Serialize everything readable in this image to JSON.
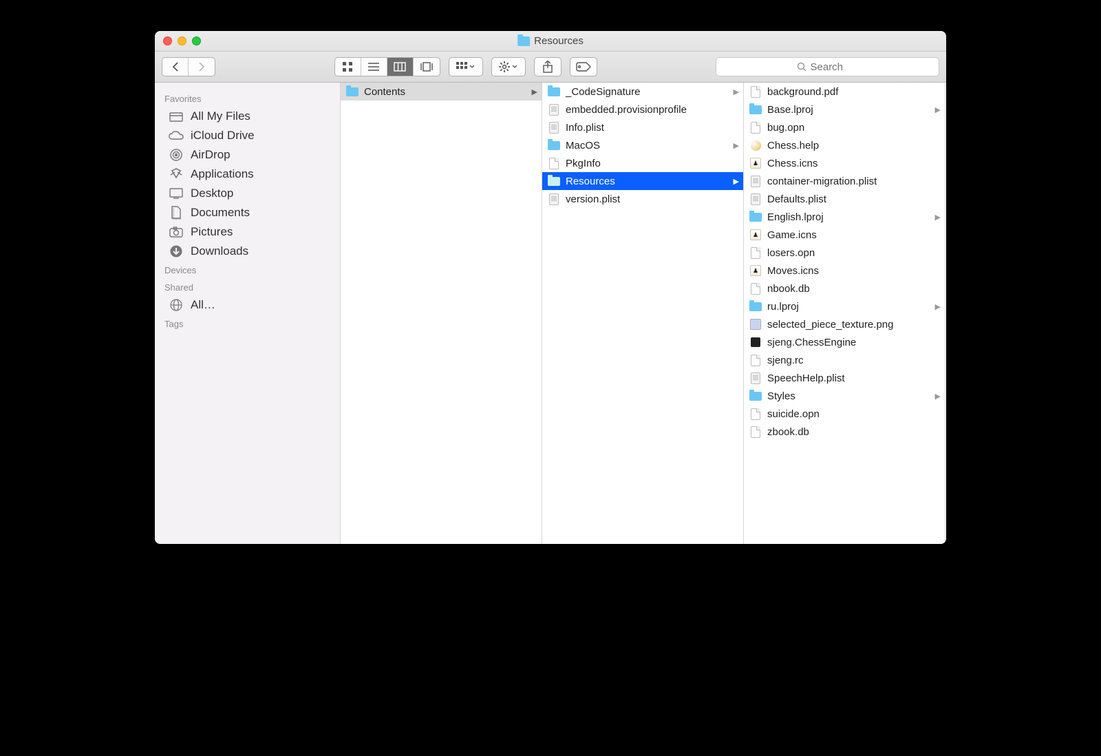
{
  "window": {
    "title": "Resources"
  },
  "toolbar": {
    "search_placeholder": "Search"
  },
  "sidebar": {
    "sections": [
      {
        "header": "Favorites",
        "items": [
          {
            "label": "All My Files",
            "icon": "all-files"
          },
          {
            "label": "iCloud Drive",
            "icon": "icloud"
          },
          {
            "label": "AirDrop",
            "icon": "airdrop"
          },
          {
            "label": "Applications",
            "icon": "apps"
          },
          {
            "label": "Desktop",
            "icon": "desktop"
          },
          {
            "label": "Documents",
            "icon": "documents"
          },
          {
            "label": "Pictures",
            "icon": "pictures"
          },
          {
            "label": "Downloads",
            "icon": "downloads"
          }
        ]
      },
      {
        "header": "Devices",
        "items": []
      },
      {
        "header": "Shared",
        "items": [
          {
            "label": "All…",
            "icon": "network"
          }
        ]
      },
      {
        "header": "Tags",
        "items": []
      }
    ]
  },
  "columns": [
    {
      "items": [
        {
          "name": "Contents",
          "type": "folder",
          "has_children": true,
          "state": "path"
        }
      ]
    },
    {
      "items": [
        {
          "name": "_CodeSignature",
          "type": "folder",
          "has_children": true
        },
        {
          "name": "embedded.provisionprofile",
          "type": "plist"
        },
        {
          "name": "Info.plist",
          "type": "plist"
        },
        {
          "name": "MacOS",
          "type": "folder",
          "has_children": true
        },
        {
          "name": "PkgInfo",
          "type": "doc"
        },
        {
          "name": "Resources",
          "type": "folder",
          "has_children": true,
          "state": "active"
        },
        {
          "name": "version.plist",
          "type": "plist"
        }
      ]
    },
    {
      "items": [
        {
          "name": "background.pdf",
          "type": "doc"
        },
        {
          "name": "Base.lproj",
          "type": "folder",
          "has_children": true
        },
        {
          "name": "bug.opn",
          "type": "doc"
        },
        {
          "name": "Chess.help",
          "type": "help"
        },
        {
          "name": "Chess.icns",
          "type": "icns"
        },
        {
          "name": "container-migration.plist",
          "type": "plist"
        },
        {
          "name": "Defaults.plist",
          "type": "plist"
        },
        {
          "name": "English.lproj",
          "type": "folder",
          "has_children": true
        },
        {
          "name": "Game.icns",
          "type": "icns"
        },
        {
          "name": "losers.opn",
          "type": "doc"
        },
        {
          "name": "Moves.icns",
          "type": "icns"
        },
        {
          "name": "nbook.db",
          "type": "doc"
        },
        {
          "name": "ru.lproj",
          "type": "folder",
          "has_children": true
        },
        {
          "name": "selected_piece_texture.png",
          "type": "png"
        },
        {
          "name": "sjeng.ChessEngine",
          "type": "exec"
        },
        {
          "name": "sjeng.rc",
          "type": "doc"
        },
        {
          "name": "SpeechHelp.plist",
          "type": "plist"
        },
        {
          "name": "Styles",
          "type": "folder",
          "has_children": true
        },
        {
          "name": "suicide.opn",
          "type": "doc"
        },
        {
          "name": "zbook.db",
          "type": "doc"
        }
      ]
    }
  ]
}
